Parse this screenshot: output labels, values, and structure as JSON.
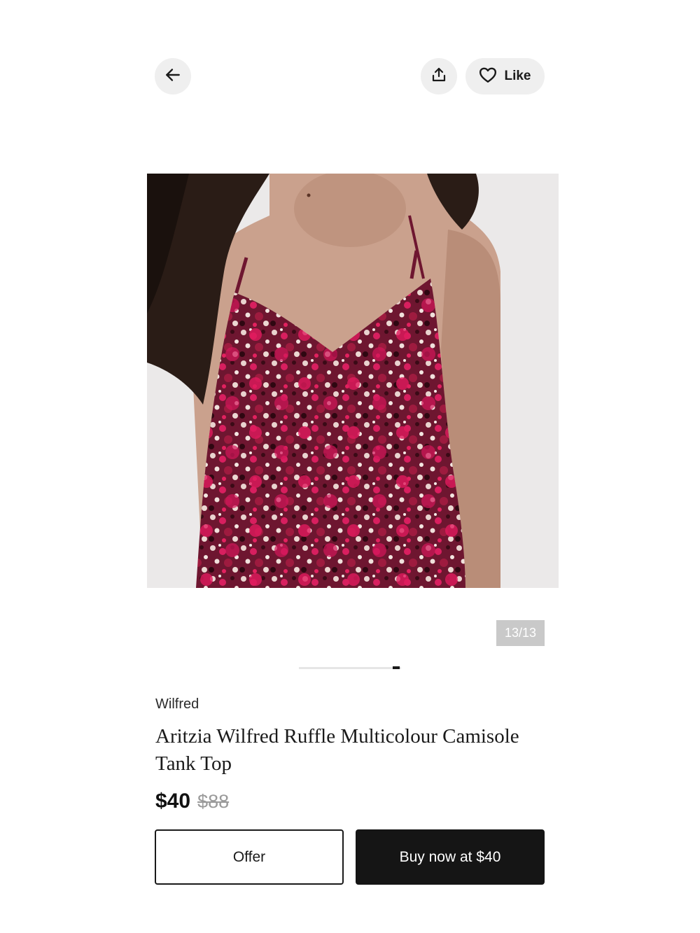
{
  "topbar": {
    "back_icon": "arrow-left-icon",
    "share_icon": "share-icon",
    "like_icon": "heart-icon",
    "like_label": "Like"
  },
  "gallery": {
    "counter": "13/13",
    "current_index": 13,
    "total": 13
  },
  "product": {
    "brand": "Wilfred",
    "title": "Aritzia Wilfred Ruffle Multicolour Camisole Tank Top",
    "price": "$40",
    "original_price": "$88"
  },
  "actions": {
    "offer_label": "Offer",
    "buy_label": "Buy now at $40"
  },
  "colors": {
    "button_bg": "#efefef",
    "primary_cta": "#151515",
    "counter_bg": "#c9c9c9"
  }
}
